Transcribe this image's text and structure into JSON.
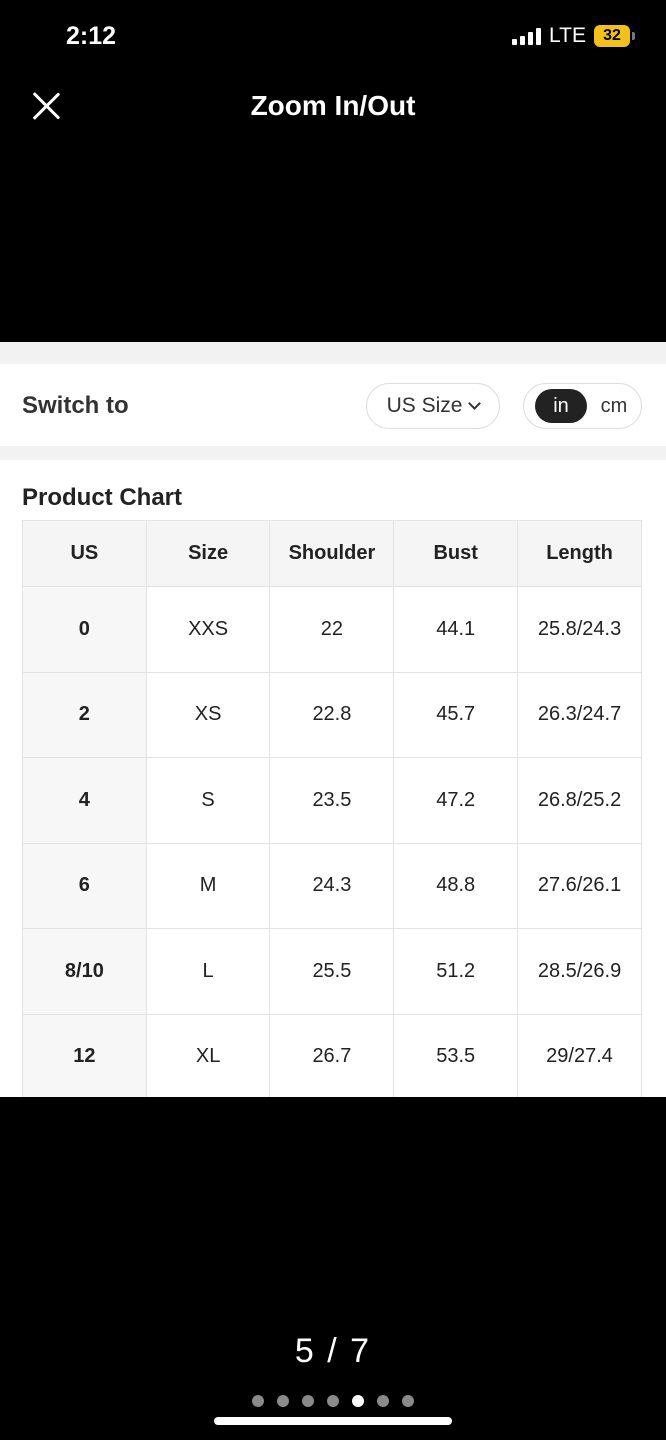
{
  "status_bar": {
    "time": "2:12",
    "network": "LTE",
    "battery": "32"
  },
  "header": {
    "title": "Zoom In/Out"
  },
  "switcher": {
    "label": "Switch to",
    "size_system": "US Size",
    "unit_active": "in",
    "unit_other": "cm"
  },
  "chart": {
    "title": "Product Chart",
    "columns": [
      "US",
      "Size",
      "Shoulder",
      "Bust",
      "Length"
    ],
    "rows": [
      [
        "0",
        "XXS",
        "22",
        "44.1",
        "25.8/24.3"
      ],
      [
        "2",
        "XS",
        "22.8",
        "45.7",
        "26.3/24.7"
      ],
      [
        "4",
        "S",
        "23.5",
        "47.2",
        "26.8/25.2"
      ],
      [
        "6",
        "M",
        "24.3",
        "48.8",
        "27.6/26.1"
      ],
      [
        "8/10",
        "L",
        "25.5",
        "51.2",
        "28.5/26.9"
      ],
      [
        "12",
        "XL",
        "26.7",
        "53.5",
        "29/27.4"
      ]
    ]
  },
  "pager": {
    "text": "5 / 7",
    "current": 5,
    "total": 7
  }
}
